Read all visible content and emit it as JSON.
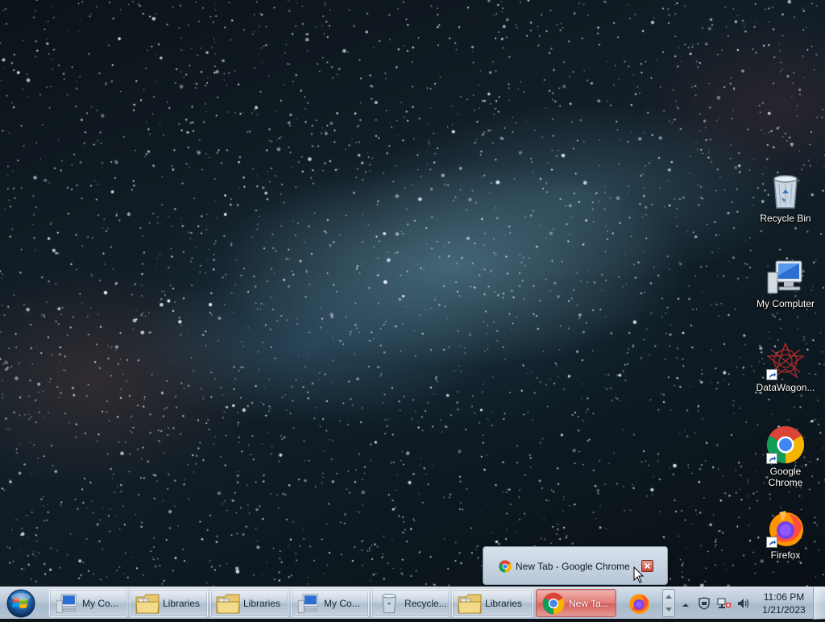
{
  "desktop": {
    "icons": [
      {
        "label": "Recycle Bin",
        "icon": "recycle-bin-icon"
      },
      {
        "label": "My Computer",
        "icon": "computer-icon"
      },
      {
        "label": "DataWagon...",
        "icon": "datawagon-icon"
      },
      {
        "label": "Google Chrome",
        "icon": "chrome-icon"
      },
      {
        "label": "Firefox",
        "icon": "firefox-icon"
      }
    ]
  },
  "taskbar": {
    "start_icon": "windows-orb-icon",
    "items": [
      {
        "label": "My Co...",
        "icon": "computer-icon"
      },
      {
        "label": "Libraries",
        "icon": "folder-icon"
      },
      {
        "label": "Libraries",
        "icon": "folder-icon"
      },
      {
        "label": "My Co...",
        "icon": "computer-icon"
      },
      {
        "label": "Recycle...",
        "icon": "recycle-bin-icon"
      },
      {
        "label": "Libraries",
        "icon": "folder-icon"
      },
      {
        "label": "New Ta...",
        "icon": "chrome-icon",
        "active": true
      },
      {
        "label": "",
        "icon": "firefox-icon"
      }
    ],
    "clock": {
      "time": "11:06 PM",
      "date": "1/21/2023"
    }
  },
  "preview": {
    "title": "New Tab - Google Chrome",
    "icon": "chrome-icon"
  },
  "colors": {
    "taskbar_top": "#d5dfea",
    "taskbar_bottom": "#a8bacd",
    "active_task": "#e27c78"
  }
}
